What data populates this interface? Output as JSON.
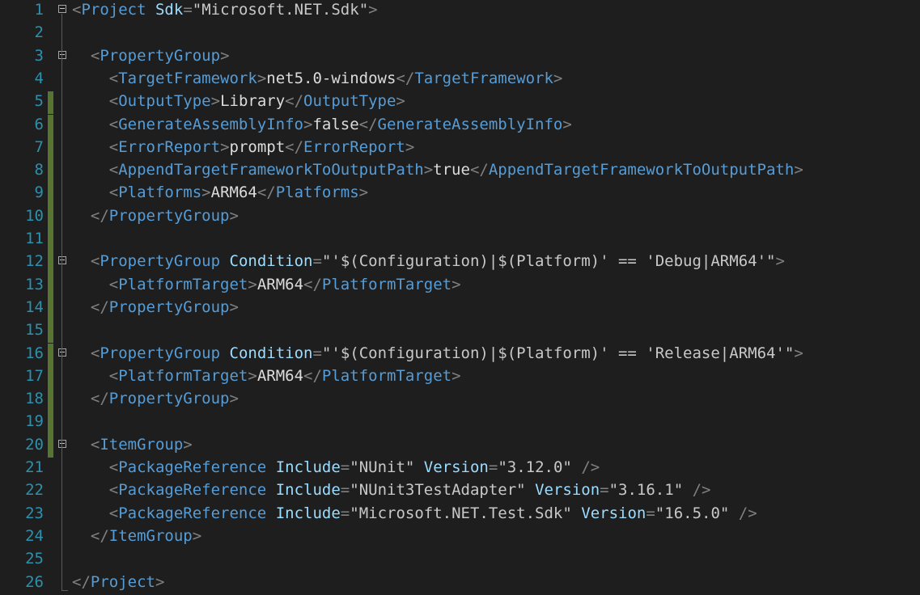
{
  "editor": {
    "colors": {
      "background": "#1e1e1e",
      "line_number": "#2b91af",
      "delimiter": "#808080",
      "element": "#569cd6",
      "attribute": "#9cdcfe",
      "value": "#c8c8c8",
      "text": "#dcdcdc",
      "change_marker": "#577430",
      "fold_box": "#a5a5a5"
    },
    "lines": [
      {
        "n": "1",
        "changed": false,
        "fold": true,
        "tokens": [
          [
            "delim",
            "<"
          ],
          [
            "elem",
            "Project"
          ],
          [
            "space",
            " "
          ],
          [
            "attr",
            "Sdk"
          ],
          [
            "delim",
            "="
          ],
          [
            "quote",
            "\""
          ],
          [
            "value",
            "Microsoft.NET.Sdk"
          ],
          [
            "quote",
            "\""
          ],
          [
            "delim",
            ">"
          ]
        ]
      },
      {
        "n": "2",
        "changed": false,
        "fold": false,
        "tokens": []
      },
      {
        "n": "3",
        "changed": false,
        "fold": true,
        "tokens": [
          [
            "space",
            "  "
          ],
          [
            "delim",
            "<"
          ],
          [
            "elem",
            "PropertyGroup"
          ],
          [
            "delim",
            ">"
          ]
        ]
      },
      {
        "n": "4",
        "changed": false,
        "fold": false,
        "tokens": [
          [
            "space",
            "    "
          ],
          [
            "delim",
            "<"
          ],
          [
            "elem",
            "TargetFramework"
          ],
          [
            "delim",
            ">"
          ],
          [
            "text",
            "net5.0-windows"
          ],
          [
            "delim",
            "</"
          ],
          [
            "elem",
            "TargetFramework"
          ],
          [
            "delim",
            ">"
          ]
        ]
      },
      {
        "n": "5",
        "changed": true,
        "fold": false,
        "tokens": [
          [
            "space",
            "    "
          ],
          [
            "delim",
            "<"
          ],
          [
            "elem",
            "OutputType"
          ],
          [
            "delim",
            ">"
          ],
          [
            "text",
            "Library"
          ],
          [
            "delim",
            "</"
          ],
          [
            "elem",
            "OutputType"
          ],
          [
            "delim",
            ">"
          ]
        ]
      },
      {
        "n": "6",
        "changed": true,
        "fold": false,
        "tokens": [
          [
            "space",
            "    "
          ],
          [
            "delim",
            "<"
          ],
          [
            "elem",
            "GenerateAssemblyInfo"
          ],
          [
            "delim",
            ">"
          ],
          [
            "text",
            "false"
          ],
          [
            "delim",
            "</"
          ],
          [
            "elem",
            "GenerateAssemblyInfo"
          ],
          [
            "delim",
            ">"
          ]
        ]
      },
      {
        "n": "7",
        "changed": true,
        "fold": false,
        "tokens": [
          [
            "space",
            "    "
          ],
          [
            "delim",
            "<"
          ],
          [
            "elem",
            "ErrorReport"
          ],
          [
            "delim",
            ">"
          ],
          [
            "text",
            "prompt"
          ],
          [
            "delim",
            "</"
          ],
          [
            "elem",
            "ErrorReport"
          ],
          [
            "delim",
            ">"
          ]
        ]
      },
      {
        "n": "8",
        "changed": true,
        "fold": false,
        "tokens": [
          [
            "space",
            "    "
          ],
          [
            "delim",
            "<"
          ],
          [
            "elem",
            "AppendTargetFrameworkToOutputPath"
          ],
          [
            "delim",
            ">"
          ],
          [
            "text",
            "true"
          ],
          [
            "delim",
            "</"
          ],
          [
            "elem",
            "AppendTargetFrameworkToOutputPath"
          ],
          [
            "delim",
            ">"
          ]
        ]
      },
      {
        "n": "9",
        "changed": true,
        "fold": false,
        "tokens": [
          [
            "space",
            "    "
          ],
          [
            "delim",
            "<"
          ],
          [
            "elem",
            "Platforms"
          ],
          [
            "delim",
            ">"
          ],
          [
            "text",
            "ARM64"
          ],
          [
            "delim",
            "</"
          ],
          [
            "elem",
            "Platforms"
          ],
          [
            "delim",
            ">"
          ]
        ]
      },
      {
        "n": "10",
        "changed": true,
        "fold": false,
        "tokens": [
          [
            "space",
            "  "
          ],
          [
            "delim",
            "</"
          ],
          [
            "elem",
            "PropertyGroup"
          ],
          [
            "delim",
            ">"
          ]
        ]
      },
      {
        "n": "11",
        "changed": true,
        "fold": false,
        "tokens": []
      },
      {
        "n": "12",
        "changed": true,
        "fold": true,
        "tokens": [
          [
            "space",
            "  "
          ],
          [
            "delim",
            "<"
          ],
          [
            "elem",
            "PropertyGroup"
          ],
          [
            "space",
            " "
          ],
          [
            "attr",
            "Condition"
          ],
          [
            "delim",
            "="
          ],
          [
            "quote",
            "\""
          ],
          [
            "value",
            "'$(Configuration)|$(Platform)' == 'Debug|ARM64'"
          ],
          [
            "quote",
            "\""
          ],
          [
            "delim",
            ">"
          ]
        ]
      },
      {
        "n": "13",
        "changed": true,
        "fold": false,
        "tokens": [
          [
            "space",
            "    "
          ],
          [
            "delim",
            "<"
          ],
          [
            "elem",
            "PlatformTarget"
          ],
          [
            "delim",
            ">"
          ],
          [
            "text",
            "ARM64"
          ],
          [
            "delim",
            "</"
          ],
          [
            "elem",
            "PlatformTarget"
          ],
          [
            "delim",
            ">"
          ]
        ]
      },
      {
        "n": "14",
        "changed": true,
        "fold": false,
        "tokens": [
          [
            "space",
            "  "
          ],
          [
            "delim",
            "</"
          ],
          [
            "elem",
            "PropertyGroup"
          ],
          [
            "delim",
            ">"
          ]
        ]
      },
      {
        "n": "15",
        "changed": true,
        "fold": false,
        "tokens": []
      },
      {
        "n": "16",
        "changed": true,
        "fold": true,
        "tokens": [
          [
            "space",
            "  "
          ],
          [
            "delim",
            "<"
          ],
          [
            "elem",
            "PropertyGroup"
          ],
          [
            "space",
            " "
          ],
          [
            "attr",
            "Condition"
          ],
          [
            "delim",
            "="
          ],
          [
            "quote",
            "\""
          ],
          [
            "value",
            "'$(Configuration)|$(Platform)' == 'Release|ARM64'"
          ],
          [
            "quote",
            "\""
          ],
          [
            "delim",
            ">"
          ]
        ]
      },
      {
        "n": "17",
        "changed": true,
        "fold": false,
        "tokens": [
          [
            "space",
            "    "
          ],
          [
            "delim",
            "<"
          ],
          [
            "elem",
            "PlatformTarget"
          ],
          [
            "delim",
            ">"
          ],
          [
            "text",
            "ARM64"
          ],
          [
            "delim",
            "</"
          ],
          [
            "elem",
            "PlatformTarget"
          ],
          [
            "delim",
            ">"
          ]
        ]
      },
      {
        "n": "18",
        "changed": true,
        "fold": false,
        "tokens": [
          [
            "space",
            "  "
          ],
          [
            "delim",
            "</"
          ],
          [
            "elem",
            "PropertyGroup"
          ],
          [
            "delim",
            ">"
          ]
        ]
      },
      {
        "n": "19",
        "changed": true,
        "fold": false,
        "tokens": []
      },
      {
        "n": "20",
        "changed": true,
        "fold": true,
        "tokens": [
          [
            "space",
            "  "
          ],
          [
            "delim",
            "<"
          ],
          [
            "elem",
            "ItemGroup"
          ],
          [
            "delim",
            ">"
          ]
        ]
      },
      {
        "n": "21",
        "changed": false,
        "fold": false,
        "tokens": [
          [
            "space",
            "    "
          ],
          [
            "delim",
            "<"
          ],
          [
            "elem",
            "PackageReference"
          ],
          [
            "space",
            " "
          ],
          [
            "attr",
            "Include"
          ],
          [
            "delim",
            "="
          ],
          [
            "quote",
            "\""
          ],
          [
            "value",
            "NUnit"
          ],
          [
            "quote",
            "\""
          ],
          [
            "space",
            " "
          ],
          [
            "attr",
            "Version"
          ],
          [
            "delim",
            "="
          ],
          [
            "quote",
            "\""
          ],
          [
            "value",
            "3.12.0"
          ],
          [
            "quote",
            "\""
          ],
          [
            "space",
            " "
          ],
          [
            "delim",
            "/>"
          ]
        ]
      },
      {
        "n": "22",
        "changed": false,
        "fold": false,
        "tokens": [
          [
            "space",
            "    "
          ],
          [
            "delim",
            "<"
          ],
          [
            "elem",
            "PackageReference"
          ],
          [
            "space",
            " "
          ],
          [
            "attr",
            "Include"
          ],
          [
            "delim",
            "="
          ],
          [
            "quote",
            "\""
          ],
          [
            "value",
            "NUnit3TestAdapter"
          ],
          [
            "quote",
            "\""
          ],
          [
            "space",
            " "
          ],
          [
            "attr",
            "Version"
          ],
          [
            "delim",
            "="
          ],
          [
            "quote",
            "\""
          ],
          [
            "value",
            "3.16.1"
          ],
          [
            "quote",
            "\""
          ],
          [
            "space",
            " "
          ],
          [
            "delim",
            "/>"
          ]
        ]
      },
      {
        "n": "23",
        "changed": false,
        "fold": false,
        "tokens": [
          [
            "space",
            "    "
          ],
          [
            "delim",
            "<"
          ],
          [
            "elem",
            "PackageReference"
          ],
          [
            "space",
            " "
          ],
          [
            "attr",
            "Include"
          ],
          [
            "delim",
            "="
          ],
          [
            "quote",
            "\""
          ],
          [
            "value",
            "Microsoft.NET.Test.Sdk"
          ],
          [
            "quote",
            "\""
          ],
          [
            "space",
            " "
          ],
          [
            "attr",
            "Version"
          ],
          [
            "delim",
            "="
          ],
          [
            "quote",
            "\""
          ],
          [
            "value",
            "16.5.0"
          ],
          [
            "quote",
            "\""
          ],
          [
            "space",
            " "
          ],
          [
            "delim",
            "/>"
          ]
        ]
      },
      {
        "n": "24",
        "changed": false,
        "fold": false,
        "tokens": [
          [
            "space",
            "  "
          ],
          [
            "delim",
            "</"
          ],
          [
            "elem",
            "ItemGroup"
          ],
          [
            "delim",
            ">"
          ]
        ]
      },
      {
        "n": "25",
        "changed": false,
        "fold": false,
        "tokens": []
      },
      {
        "n": "26",
        "changed": false,
        "fold": false,
        "tokens": [
          [
            "delim",
            "</"
          ],
          [
            "elem",
            "Project"
          ],
          [
            "delim",
            ">"
          ]
        ]
      }
    ]
  }
}
